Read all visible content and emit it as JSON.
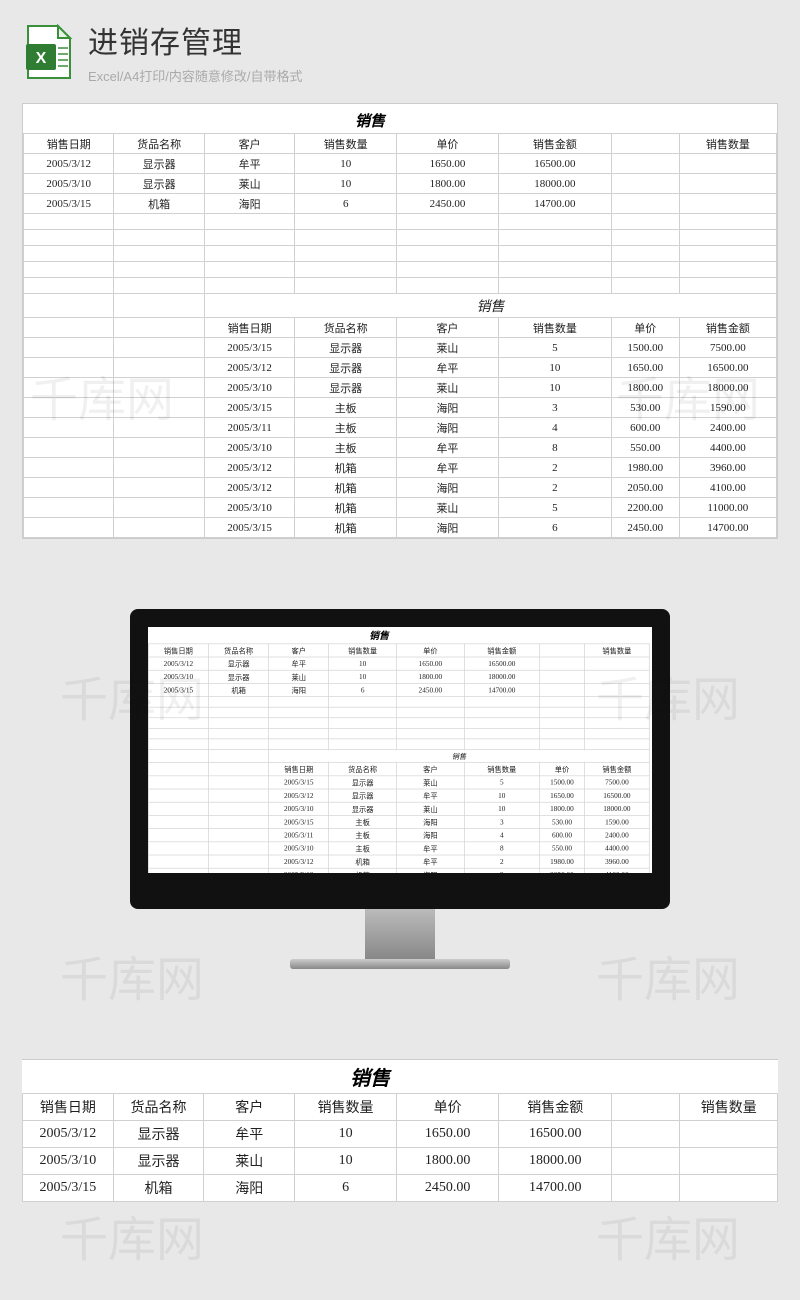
{
  "watermark_text": "千库网",
  "header": {
    "title": "进销存管理",
    "subtitle": "Excel/A4打印/内容随意修改/自带格式"
  },
  "table1": {
    "title": "销售",
    "columns": [
      "销售日期",
      "货品名称",
      "客户",
      "销售数量",
      "单价",
      "销售金额"
    ],
    "extra_col": "销售数量",
    "rows": [
      [
        "2005/3/12",
        "显示器",
        "牟平",
        "10",
        "1650.00",
        "16500.00"
      ],
      [
        "2005/3/10",
        "显示器",
        "莱山",
        "10",
        "1800.00",
        "18000.00"
      ],
      [
        "2005/3/15",
        "机箱",
        "海阳",
        "6",
        "2450.00",
        "14700.00"
      ]
    ]
  },
  "table2": {
    "title": "销售",
    "columns": [
      "销售日期",
      "货品名称",
      "客户",
      "销售数量",
      "单价",
      "销售金额"
    ],
    "rows": [
      [
        "2005/3/15",
        "显示器",
        "莱山",
        "5",
        "1500.00",
        "7500.00"
      ],
      [
        "2005/3/12",
        "显示器",
        "牟平",
        "10",
        "1650.00",
        "16500.00"
      ],
      [
        "2005/3/10",
        "显示器",
        "莱山",
        "10",
        "1800.00",
        "18000.00"
      ],
      [
        "2005/3/15",
        "主板",
        "海阳",
        "3",
        "530.00",
        "1590.00"
      ],
      [
        "2005/3/11",
        "主板",
        "海阳",
        "4",
        "600.00",
        "2400.00"
      ],
      [
        "2005/3/10",
        "主板",
        "牟平",
        "8",
        "550.00",
        "4400.00"
      ],
      [
        "2005/3/12",
        "机箱",
        "牟平",
        "2",
        "1980.00",
        "3960.00"
      ],
      [
        "2005/3/12",
        "机箱",
        "海阳",
        "2",
        "2050.00",
        "4100.00"
      ],
      [
        "2005/3/10",
        "机箱",
        "莱山",
        "5",
        "2200.00",
        "11000.00"
      ],
      [
        "2005/3/15",
        "机箱",
        "海阳",
        "6",
        "2450.00",
        "14700.00"
      ]
    ]
  }
}
